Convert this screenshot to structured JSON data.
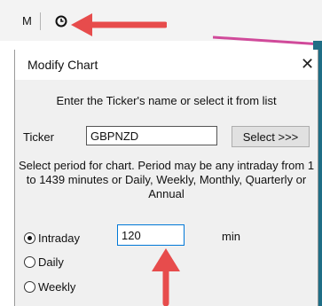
{
  "toolbar": {
    "m_label": "M",
    "clock_icon": "clock-icon"
  },
  "dialog": {
    "title": "Modify Chart",
    "close_icon": "✕",
    "prompt": "Enter the Ticker's name or select it from list",
    "ticker_label": "Ticker",
    "ticker_value": "GBPNZD",
    "select_button": "Select >>>",
    "description": "Select period for chart. Period may be any intraday from 1 to 1439 minutes or Daily, Weekly, Monthly, Quarterly or Annual",
    "periods": [
      {
        "label": "Intraday",
        "checked": true
      },
      {
        "label": "Daily",
        "checked": false
      },
      {
        "label": "Weekly",
        "checked": false
      }
    ],
    "minutes_value": "120",
    "minutes_unit": "min"
  },
  "colors": {
    "arrow": "#e74c4c",
    "accent": "#0078d7",
    "chart_bg": "#1f6e86"
  }
}
